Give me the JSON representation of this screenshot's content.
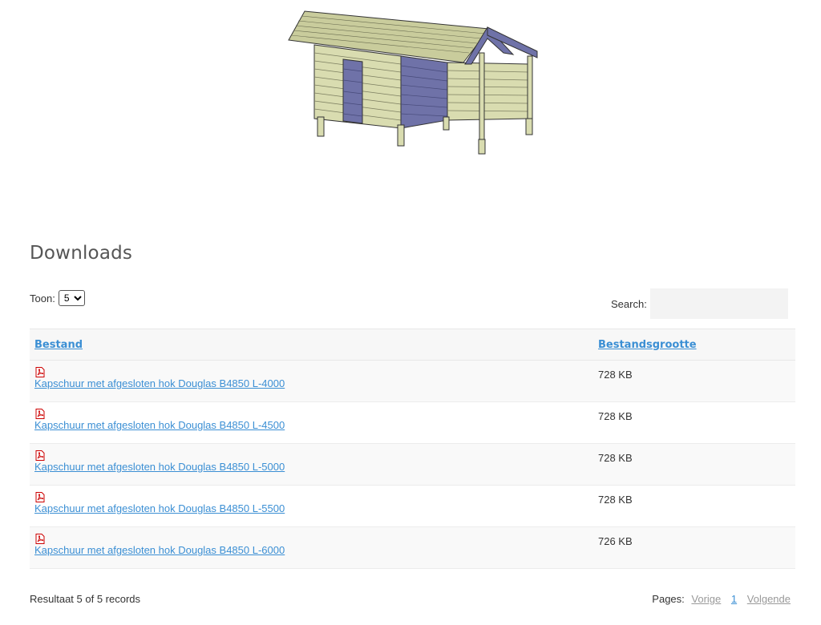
{
  "section": {
    "title": "Downloads"
  },
  "controls": {
    "show_label": "Toon:",
    "show_options": [
      "5"
    ],
    "show_selected": "5",
    "search_label": "Search:",
    "search_value": ""
  },
  "table": {
    "headers": {
      "file": "Bestand",
      "size": "Bestandsgrootte"
    },
    "rows": [
      {
        "name": "Kapschuur met afgesloten hok Douglas B4850 L-4000",
        "size": "728 KB",
        "icon": "pdf-icon"
      },
      {
        "name": "Kapschuur met afgesloten hok Douglas B4850 L-4500",
        "size": "728 KB",
        "icon": "pdf-icon"
      },
      {
        "name": "Kapschuur met afgesloten hok Douglas B4850 L-5000",
        "size": "728 KB",
        "icon": "pdf-icon"
      },
      {
        "name": "Kapschuur met afgesloten hok Douglas B4850 L-5500",
        "size": "728 KB",
        "icon": "pdf-icon"
      },
      {
        "name": "Kapschuur met afgesloten hok Douglas B4850 L-6000",
        "size": "726 KB",
        "icon": "pdf-icon"
      }
    ]
  },
  "footer": {
    "result_text": "Resultaat 5 of 5 records",
    "pages_label": "Pages:",
    "prev": "Vorige",
    "current_page": "1",
    "next": "Volgende"
  },
  "colors": {
    "link": "#3b8fd4",
    "disabled_link": "#999999",
    "row_alt": "#f9f9f9",
    "header_bg": "#f7f7f7"
  }
}
